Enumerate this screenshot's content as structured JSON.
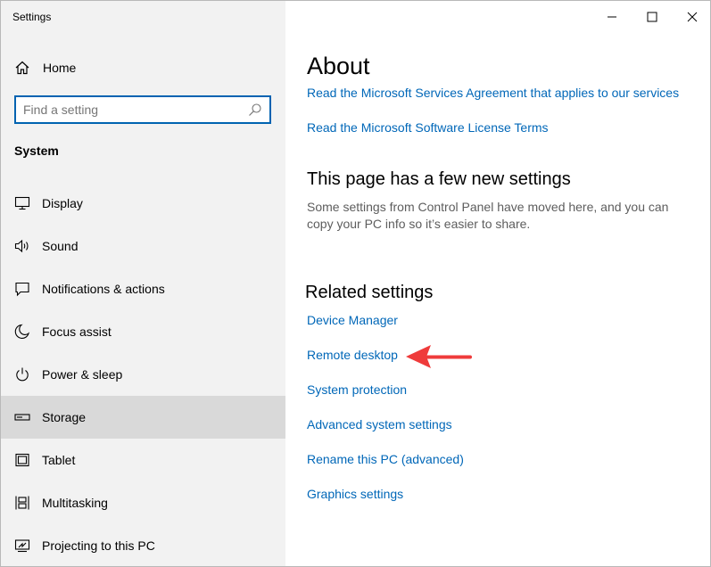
{
  "window": {
    "title": "Settings",
    "controls": [
      "minimize",
      "maximize",
      "close"
    ]
  },
  "sidebar": {
    "home_label": "Home",
    "search": {
      "placeholder": "Find a setting",
      "value": ""
    },
    "section_label": "System",
    "items": [
      {
        "label": "Display",
        "icon": "display-icon",
        "selected": false
      },
      {
        "label": "Sound",
        "icon": "sound-icon",
        "selected": false
      },
      {
        "label": "Notifications & actions",
        "icon": "notifications-icon",
        "selected": false
      },
      {
        "label": "Focus assist",
        "icon": "moon-icon",
        "selected": false
      },
      {
        "label": "Power & sleep",
        "icon": "power-icon",
        "selected": false
      },
      {
        "label": "Storage",
        "icon": "storage-icon",
        "selected": true
      },
      {
        "label": "Tablet",
        "icon": "tablet-icon",
        "selected": false
      },
      {
        "label": "Multitasking",
        "icon": "multitasking-icon",
        "selected": false
      },
      {
        "label": "Projecting to this PC",
        "icon": "projecting-icon",
        "selected": false
      }
    ]
  },
  "main": {
    "title": "About",
    "links_top": [
      "Read the Microsoft Services Agreement that applies to our services",
      "Read the Microsoft Software License Terms"
    ],
    "new_settings_heading": "This page has a few new settings",
    "new_settings_desc": "Some settings from Control Panel have moved here, and you can copy your PC info so it’s easier to share.",
    "related_heading": "Related settings",
    "related_links": [
      "Device Manager",
      "Remote desktop",
      "System protection",
      "Advanced system settings",
      "Rename this PC (advanced)",
      "Graphics settings"
    ]
  },
  "colors": {
    "link": "#0067b8",
    "accent_border": "#0063b1",
    "sidebar_bg": "#f2f2f2",
    "selected_bg": "#d9d9d9",
    "annotation_arrow": "#ef3b3b"
  }
}
